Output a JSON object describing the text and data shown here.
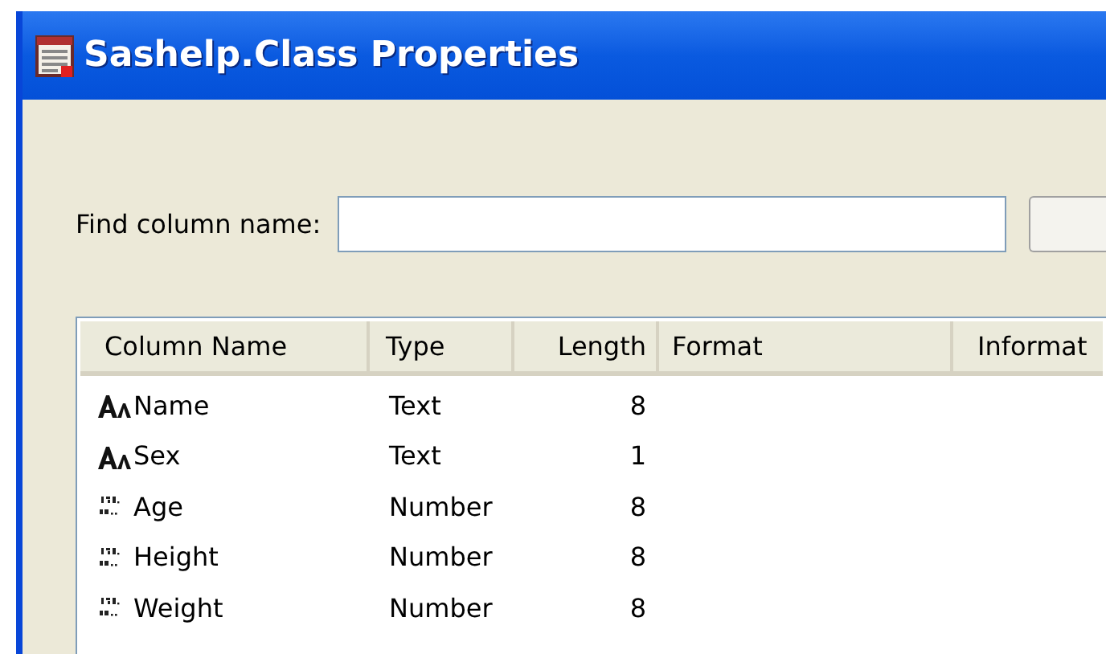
{
  "window": {
    "title": "Sashelp.Class Properties"
  },
  "find": {
    "label": "Find column name:"
  },
  "table": {
    "columns": [
      "Column Name",
      "Type",
      "Length",
      "Format",
      "Informat"
    ],
    "rows": [
      {
        "kind": "text",
        "name": "Name",
        "type": "Text",
        "length": "8"
      },
      {
        "kind": "text",
        "name": "Sex",
        "type": "Text",
        "length": "1"
      },
      {
        "kind": "number",
        "name": "Age",
        "type": "Number",
        "length": "8"
      },
      {
        "kind": "number",
        "name": "Height",
        "type": "Number",
        "length": "8"
      },
      {
        "kind": "number",
        "name": "Weight",
        "type": "Number",
        "length": "8"
      }
    ]
  }
}
